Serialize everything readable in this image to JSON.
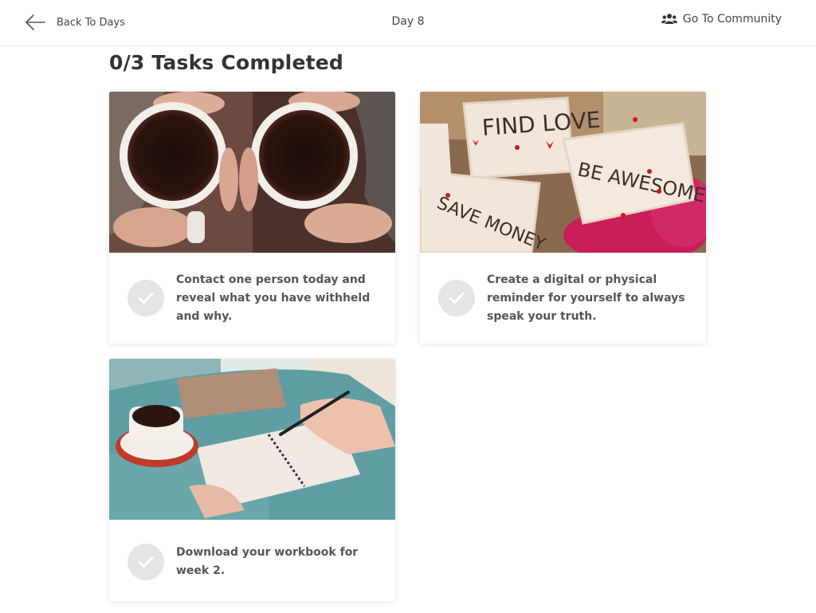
{
  "header": {
    "back_label": "Back To Days",
    "day_title": "Day 8",
    "community_label": "Go To Community"
  },
  "main": {
    "heading": "0/3 Tasks Completed",
    "tasks": [
      {
        "text": "Contact one person today and reveal what you have withheld and why.",
        "image": "coffee-cups-photo",
        "completed": false
      },
      {
        "text": "Create a digital or physical reminder for yourself to always speak your truth.",
        "image": "find-love-be-awesome-notes-photo",
        "image_text": [
          "FIND LOVE",
          "BE AWESOME",
          "SAVE MONEY"
        ],
        "completed": false
      },
      {
        "text": "Download your workbook for week 2.",
        "image": "coffee-and-notebook-writing-photo",
        "completed": false
      }
    ]
  },
  "colors": {
    "check_circle": "#e4e4e4",
    "task_text": "#555555",
    "heading": "#333333"
  }
}
